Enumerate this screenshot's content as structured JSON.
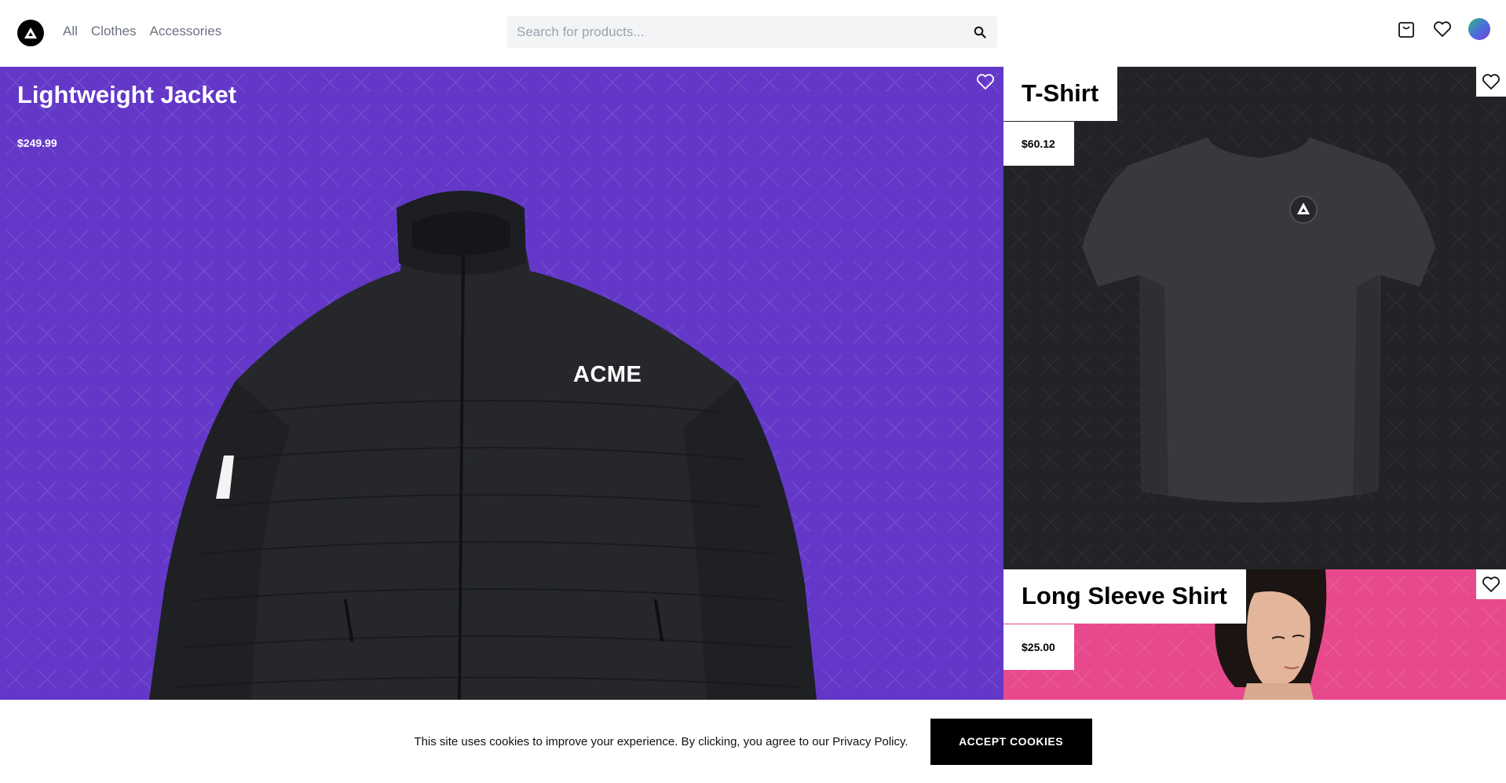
{
  "header": {
    "logo_icon": "acme-triangle-logo",
    "nav": [
      {
        "label": "All"
      },
      {
        "label": "Clothes"
      },
      {
        "label": "Accessories"
      }
    ],
    "search": {
      "placeholder": "Search for products...",
      "icon": "search-icon"
    },
    "actions": [
      {
        "icon": "shopping-bag-icon"
      },
      {
        "icon": "heart-icon"
      },
      {
        "icon": "avatar"
      }
    ]
  },
  "products": [
    {
      "title": "Lightweight Jacket",
      "price": "$249.99",
      "background": "#6338c8",
      "print": "ACME"
    },
    {
      "title": "T-Shirt",
      "price": "$60.12",
      "background": "#212327"
    },
    {
      "title": "Long Sleeve Shirt",
      "price": "$25.00",
      "background": "#e8498d"
    }
  ],
  "cookie_banner": {
    "message": "This site uses cookies to improve your experience. By clicking, you agree to our Privacy Policy.",
    "button_label": "ACCEPT COOKIES"
  }
}
